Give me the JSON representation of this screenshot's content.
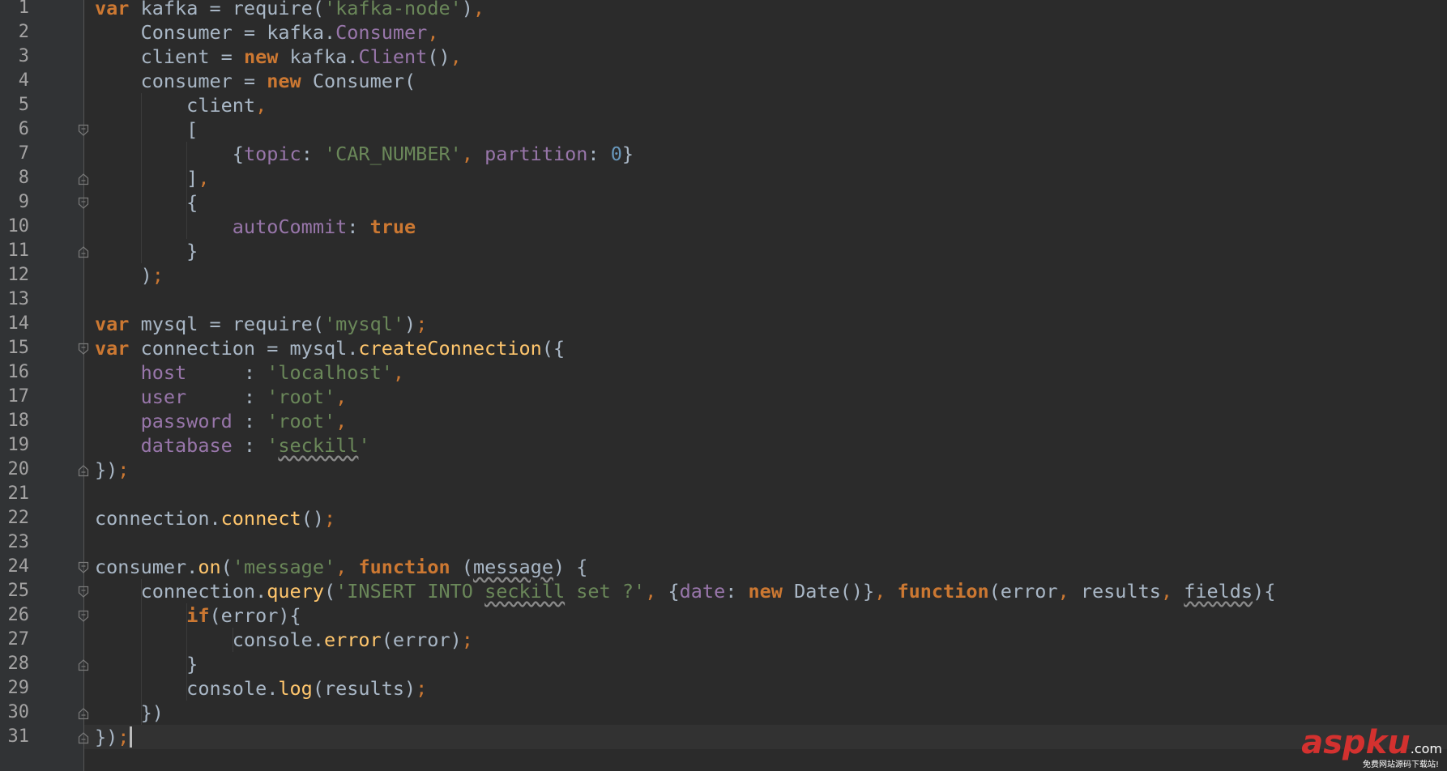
{
  "editor": {
    "language": "javascript",
    "theme": "darcula",
    "current_line": 31,
    "lines": [
      {
        "n": "1",
        "tokens": [
          [
            "k",
            "var"
          ],
          [
            "t",
            " kafka = require("
          ],
          [
            "s",
            "'kafka-node'"
          ],
          [
            "t",
            ")"
          ],
          [
            "o",
            ","
          ]
        ]
      },
      {
        "n": "2",
        "tokens": [
          [
            "t",
            "    Consumer = kafka."
          ],
          [
            "p",
            "Consumer"
          ],
          [
            "o",
            ","
          ]
        ]
      },
      {
        "n": "3",
        "tokens": [
          [
            "t",
            "    client = "
          ],
          [
            "k",
            "new"
          ],
          [
            "t",
            " kafka."
          ],
          [
            "p",
            "Client"
          ],
          [
            "t",
            "()"
          ],
          [
            "o",
            ","
          ]
        ]
      },
      {
        "n": "4",
        "tokens": [
          [
            "t",
            "    consumer = "
          ],
          [
            "k",
            "new"
          ],
          [
            "t",
            " Consumer("
          ]
        ]
      },
      {
        "n": "5",
        "tokens": [
          [
            "t",
            "        client"
          ],
          [
            "o",
            ","
          ]
        ]
      },
      {
        "n": "6",
        "tokens": [
          [
            "t",
            "        ["
          ]
        ]
      },
      {
        "n": "7",
        "tokens": [
          [
            "t",
            "            {"
          ],
          [
            "p",
            "topic"
          ],
          [
            "t",
            ": "
          ],
          [
            "s",
            "'CAR_NUMBER'"
          ],
          [
            "o",
            ","
          ],
          [
            "t",
            " "
          ],
          [
            "p",
            "partition"
          ],
          [
            "t",
            ": "
          ],
          [
            "n",
            "0"
          ],
          [
            "t",
            "}"
          ]
        ]
      },
      {
        "n": "8",
        "tokens": [
          [
            "t",
            "        ]"
          ],
          [
            "o",
            ","
          ]
        ]
      },
      {
        "n": "9",
        "tokens": [
          [
            "t",
            "        {"
          ]
        ]
      },
      {
        "n": "10",
        "tokens": [
          [
            "t",
            "            "
          ],
          [
            "p",
            "autoCommit"
          ],
          [
            "t",
            ": "
          ],
          [
            "k",
            "true"
          ]
        ]
      },
      {
        "n": "11",
        "tokens": [
          [
            "t",
            "        }"
          ]
        ]
      },
      {
        "n": "12",
        "tokens": [
          [
            "t",
            "    )"
          ],
          [
            "o",
            ";"
          ]
        ]
      },
      {
        "n": "13",
        "tokens": []
      },
      {
        "n": "14",
        "tokens": [
          [
            "k",
            "var"
          ],
          [
            "t",
            " mysql = require("
          ],
          [
            "s",
            "'mysql'"
          ],
          [
            "t",
            ")"
          ],
          [
            "o",
            ";"
          ]
        ]
      },
      {
        "n": "15",
        "tokens": [
          [
            "k",
            "var"
          ],
          [
            "t",
            " connection = mysql."
          ],
          [
            "f",
            "createConnection"
          ],
          [
            "t",
            "({"
          ]
        ]
      },
      {
        "n": "16",
        "tokens": [
          [
            "t",
            "    "
          ],
          [
            "p",
            "host"
          ],
          [
            "t",
            "     : "
          ],
          [
            "s",
            "'localhost'"
          ],
          [
            "o",
            ","
          ]
        ]
      },
      {
        "n": "17",
        "tokens": [
          [
            "t",
            "    "
          ],
          [
            "p",
            "user"
          ],
          [
            "t",
            "     : "
          ],
          [
            "s",
            "'root'"
          ],
          [
            "o",
            ","
          ]
        ]
      },
      {
        "n": "18",
        "tokens": [
          [
            "t",
            "    "
          ],
          [
            "p",
            "password"
          ],
          [
            "t",
            " : "
          ],
          [
            "s",
            "'root'"
          ],
          [
            "o",
            ","
          ]
        ]
      },
      {
        "n": "19",
        "tokens": [
          [
            "t",
            "    "
          ],
          [
            "p",
            "database"
          ],
          [
            "t",
            " : "
          ],
          [
            "s",
            "'"
          ],
          [
            "su",
            "seckill"
          ],
          [
            "s",
            "'"
          ]
        ]
      },
      {
        "n": "20",
        "tokens": [
          [
            "t",
            "})"
          ],
          [
            "o",
            ";"
          ]
        ]
      },
      {
        "n": "21",
        "tokens": []
      },
      {
        "n": "22",
        "tokens": [
          [
            "t",
            "connection."
          ],
          [
            "f",
            "connect"
          ],
          [
            "t",
            "()"
          ],
          [
            "o",
            ";"
          ]
        ]
      },
      {
        "n": "23",
        "tokens": []
      },
      {
        "n": "24",
        "tokens": [
          [
            "t",
            "consumer."
          ],
          [
            "f",
            "on"
          ],
          [
            "t",
            "("
          ],
          [
            "s",
            "'message'"
          ],
          [
            "o",
            ","
          ],
          [
            "t",
            " "
          ],
          [
            "k",
            "function"
          ],
          [
            "t",
            " ("
          ],
          [
            "u",
            "message"
          ],
          [
            "t",
            ") {"
          ]
        ]
      },
      {
        "n": "25",
        "tokens": [
          [
            "t",
            "    connection."
          ],
          [
            "f",
            "query"
          ],
          [
            "t",
            "("
          ],
          [
            "s",
            "'INSERT INTO "
          ],
          [
            "su",
            "seckill"
          ],
          [
            "s",
            " set ?'"
          ],
          [
            "o",
            ","
          ],
          [
            "t",
            " {"
          ],
          [
            "p",
            "date"
          ],
          [
            "t",
            ": "
          ],
          [
            "k",
            "new"
          ],
          [
            "t",
            " Date()}"
          ],
          [
            "o",
            ","
          ],
          [
            "t",
            " "
          ],
          [
            "k",
            "function"
          ],
          [
            "t",
            "(error"
          ],
          [
            "o",
            ","
          ],
          [
            "t",
            " results"
          ],
          [
            "o",
            ","
          ],
          [
            "t",
            " "
          ],
          [
            "u",
            "fields"
          ],
          [
            "t",
            "){"
          ]
        ]
      },
      {
        "n": "26",
        "tokens": [
          [
            "t",
            "        "
          ],
          [
            "k",
            "if"
          ],
          [
            "t",
            "(error){"
          ]
        ]
      },
      {
        "n": "27",
        "tokens": [
          [
            "t",
            "            console."
          ],
          [
            "f",
            "error"
          ],
          [
            "t",
            "(error)"
          ],
          [
            "o",
            ";"
          ]
        ]
      },
      {
        "n": "28",
        "tokens": [
          [
            "t",
            "        }"
          ]
        ]
      },
      {
        "n": "29",
        "tokens": [
          [
            "t",
            "        console."
          ],
          [
            "f",
            "log"
          ],
          [
            "t",
            "(results)"
          ],
          [
            "o",
            ";"
          ]
        ]
      },
      {
        "n": "30",
        "tokens": [
          [
            "t",
            "    })"
          ]
        ]
      },
      {
        "n": "31",
        "tokens": [
          [
            "t",
            "})"
          ],
          [
            "o",
            ";"
          ]
        ]
      }
    ],
    "fold_markers": [
      {
        "line": 6,
        "kind": "open"
      },
      {
        "line": 8,
        "kind": "close"
      },
      {
        "line": 9,
        "kind": "open"
      },
      {
        "line": 11,
        "kind": "close"
      },
      {
        "line": 15,
        "kind": "open"
      },
      {
        "line": 20,
        "kind": "close"
      },
      {
        "line": 24,
        "kind": "open"
      },
      {
        "line": 25,
        "kind": "open"
      },
      {
        "line": 26,
        "kind": "open"
      },
      {
        "line": 28,
        "kind": "close"
      },
      {
        "line": 30,
        "kind": "close"
      },
      {
        "line": 31,
        "kind": "close"
      }
    ]
  },
  "watermark": {
    "brand_a": "asp",
    "brand_b": "ku",
    "domain": ".com",
    "tagline": "免费网站源码下载站!",
    "brand_color": "#d3312f"
  }
}
